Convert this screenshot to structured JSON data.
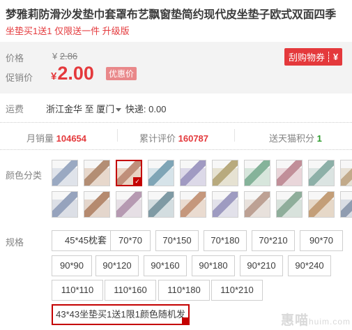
{
  "product": {
    "title": "梦雅莉防滑沙发垫巾套罩布艺飘窗垫简约现代皮坐垫子欧式双面四季",
    "subtitle": "坐垫买1送1 仅限送一件 升级版"
  },
  "price": {
    "original_label": "价格",
    "original_currency": "¥",
    "original_value": "2.86",
    "promo_label": "促销价",
    "promo_currency": "¥",
    "promo_value": "2.00",
    "promo_badge": "优惠价",
    "coupon_label": "刮购物券",
    "coupon_icon": "¥"
  },
  "shipping": {
    "label": "运费",
    "from": "浙江金华",
    "to_word": "至",
    "to": "厦门",
    "cost": "快递: 0.00"
  },
  "stats": {
    "monthly_sales_label": "月销量",
    "monthly_sales": "104654",
    "reviews_label": "累计评价",
    "reviews": "160787",
    "points_label": "送天猫积分",
    "points": "1"
  },
  "colors": {
    "label": "颜色分类",
    "selected_index": 2,
    "swatch_count": 20,
    "tints": [
      "#dfe3ea",
      "#e7d8cc",
      "#e9d2c2",
      "#d6e3e9",
      "#dcd9e8",
      "#e6e2d2",
      "#d7e6dc",
      "#e9d6da",
      "#dbe4e2",
      "#e7e1d6",
      "#dcdfe6",
      "#e4d6cc",
      "#e6dfe5",
      "#d3dde0",
      "#eadbd0",
      "#e2e1ea",
      "#e8e1dc",
      "#d8e2dc",
      "#e6d8c8",
      "#d9dde4"
    ],
    "accents": [
      "#9aa9c2",
      "#b38e74",
      "#c08f7a",
      "#7fa5b6",
      "#a09ac2",
      "#b8aa7e",
      "#85b39a",
      "#c18f99",
      "#8db0a8",
      "#c2aa8a",
      "#96a3bd",
      "#b58a6f",
      "#b69ab2",
      "#7f9aa4",
      "#c5977c",
      "#9e9bc1",
      "#bda194",
      "#8fae9b",
      "#c39e78",
      "#8f9cb0"
    ]
  },
  "specs": {
    "label": "规格",
    "options": [
      "45*45枕套",
      "70*70",
      "70*150",
      "70*180",
      "70*210",
      "90*70",
      "90*90",
      "90*120",
      "90*160",
      "90*180",
      "90*210",
      "90*240",
      "110*110",
      "110*160",
      "110*180",
      "110*210",
      "43*43坐垫买1送1限1颜色随机发"
    ],
    "selected_index": 16
  },
  "watermark": {
    "main": "惠喵",
    "sub": "huim.com"
  }
}
